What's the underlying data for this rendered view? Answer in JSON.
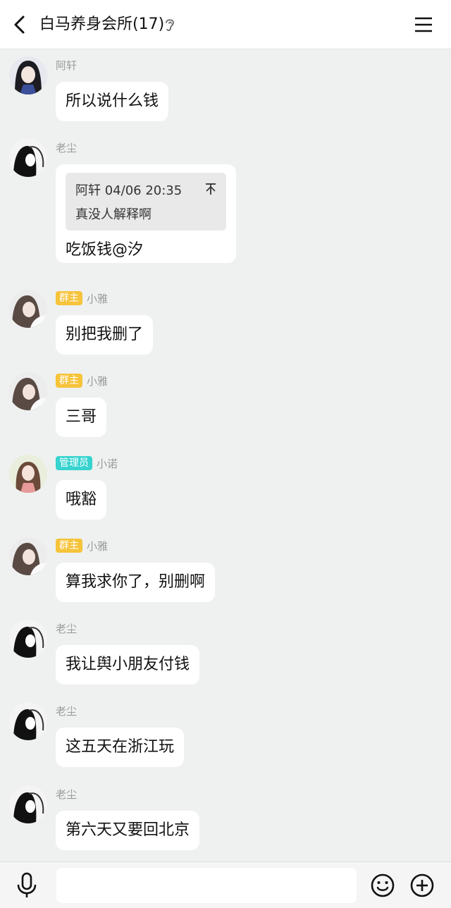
{
  "header": {
    "title": "白马养身会所(17)",
    "back_icon": "chevron-left-icon",
    "ear_icon": "ear-icon",
    "menu_icon": "hamburger-menu-icon"
  },
  "messages": [
    {
      "sender": "阿轩",
      "badge": "",
      "text": "所以说什么钱"
    },
    {
      "sender": "老尘",
      "badge": "",
      "quote_head": "阿轩 04/06 20:35",
      "quote_body": "真没人解释啊",
      "text": "吃饭钱@汐"
    },
    {
      "sender": "小雅",
      "badge": "群主",
      "text": "别把我删了"
    },
    {
      "sender": "小雅",
      "badge": "群主",
      "text": "三哥"
    },
    {
      "sender": "小诺",
      "badge": "管理员",
      "text": "哦豁"
    },
    {
      "sender": "小雅",
      "badge": "群主",
      "text": "算我求你了，别删啊"
    },
    {
      "sender": "老尘",
      "badge": "",
      "text": "我让舆小朋友付钱"
    },
    {
      "sender": "老尘",
      "badge": "",
      "text": "这五天在浙江玩"
    },
    {
      "sender": "老尘",
      "badge": "",
      "text": "第六天又要回北京"
    }
  ],
  "input_bar": {
    "placeholder": "",
    "mic_icon": "microphone-icon",
    "emoji_icon": "smiley-icon",
    "plus_icon": "plus-circle-icon"
  },
  "colors": {
    "background": "#eef1ef",
    "owner_badge": "#f6c33a",
    "admin_badge": "#36d3cf"
  }
}
